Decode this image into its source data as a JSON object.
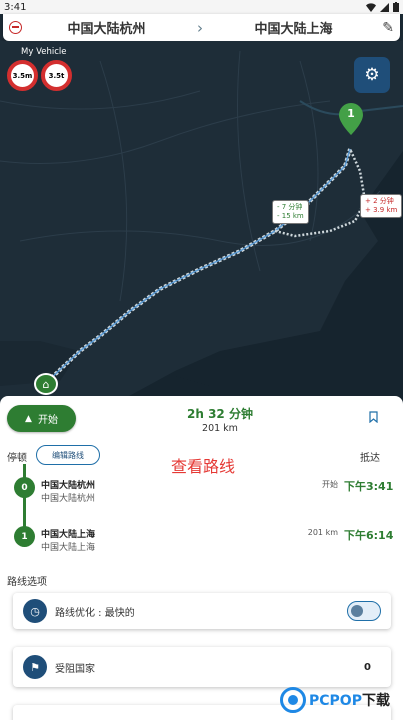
{
  "status_bar": {
    "time": "3:41"
  },
  "route_header": {
    "from": "中国大陆杭州",
    "to": "中国大陆上海"
  },
  "map": {
    "vehicle_label": "My Vehicle",
    "height_limit": "3.5m",
    "weight_limit": "3.5t",
    "destination_pin": "1",
    "alt_route_1": [
      "- 7 分钟",
      "- 15 km"
    ],
    "alt_route_2": [
      "+ 2 分钟",
      "+ 3.9 km"
    ]
  },
  "summary": {
    "start_label": "开始",
    "duration": "2h 32 分钟",
    "distance": "201 km"
  },
  "stops_section": {
    "label": "停顿",
    "edit_button": "编辑路线",
    "view_route": "查看路线",
    "arrive_label": "抵达",
    "stops": [
      {
        "index": "0",
        "name": "中国大陆杭州",
        "sub": "中国大陆杭州",
        "meta": "开始",
        "time": "下午3:41"
      },
      {
        "index": "1",
        "name": "中国大陆上海",
        "sub": "中国大陆上海",
        "meta": "201 km",
        "time": "下午6:14"
      }
    ]
  },
  "route_options": {
    "label": "路线选项",
    "optimization": "路线优化 : 最快的",
    "restricted_countries": "受阻国家",
    "restricted_count": "0"
  },
  "watermark": {
    "brand": "PCPOP",
    "suffix": "下载"
  },
  "colors": {
    "accent_green": "#2e7d32",
    "accent_blue": "#1f4e79",
    "alert_red": "#e53935"
  }
}
